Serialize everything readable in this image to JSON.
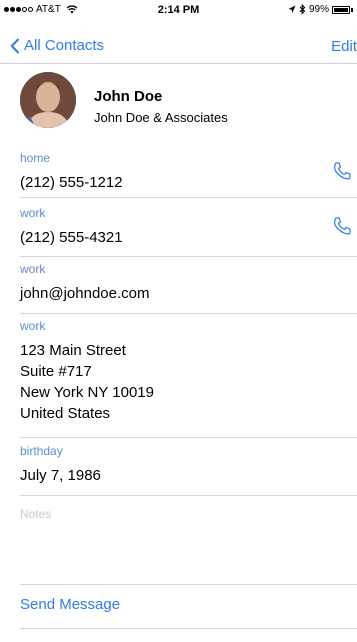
{
  "status": {
    "carrier": "AT&T",
    "time": "2:14 PM",
    "battery_percent": "99%",
    "battery_level": 0.99
  },
  "nav": {
    "back_label": "All Contacts",
    "edit_label": "Edit"
  },
  "contact": {
    "name": "John Doe",
    "company": "John Doe & Associates"
  },
  "phones": [
    {
      "label": "home",
      "value": "(212) 555-1212"
    },
    {
      "label": "work",
      "value": "(212) 555-4321"
    }
  ],
  "email": {
    "label": "work",
    "value": "john@johndoe.com"
  },
  "address": {
    "label": "work",
    "value": "123 Main Street\nSuite #717\nNew York NY 10019\nUnited States"
  },
  "birthday": {
    "label": "birthday",
    "value": "July 7, 1986"
  },
  "notes_placeholder": "Notes",
  "actions": {
    "send_message": "Send Message"
  },
  "colors": {
    "accent": "#2f7bf6",
    "field_label": "#5b8bd4"
  }
}
